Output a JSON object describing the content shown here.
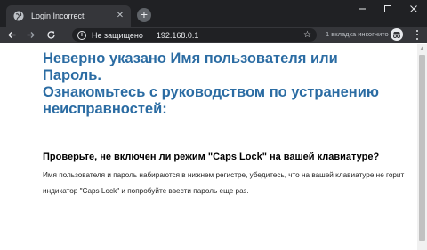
{
  "browser": {
    "tab": {
      "title": "Login Incorrect",
      "close_glyph": "✕"
    },
    "new_tab_glyph": "+",
    "window_controls": {
      "minimize": "—",
      "maximize": "☐",
      "close": "✕"
    },
    "toolbar": {
      "back_glyph": "←",
      "forward_glyph": "→",
      "reload_glyph": "C",
      "security_label": "Не защищено",
      "security_glyph": "i",
      "url": "192.168.0.1",
      "bookmark_glyph": "☆",
      "incognito_label": "1 вкладка инкогнито"
    }
  },
  "page": {
    "heading_line1": "Неверно указано Имя пользователя или Пароль.",
    "heading_line2": "Ознакомьтесь с руководством по устранению неисправностей:",
    "subheading": "Проверьте, не включен ли режим \"Caps Lock\" на вашей клавиатуре?",
    "paragraph": "Имя пользователя и пароль набираются в нижнем регистре, убедитесь, что на вашей клавиатуре не горит индикатор \"Caps Lock\" и попробуйте ввести пароль еще раз."
  },
  "colors": {
    "heading": "#2b6ca3",
    "tabstrip_bg": "#202124",
    "toolbar_bg": "#35363a"
  },
  "icons": {
    "favicon": "globe-icon",
    "incognito": "incognito-icon",
    "menu": "kebab-menu-icon"
  }
}
